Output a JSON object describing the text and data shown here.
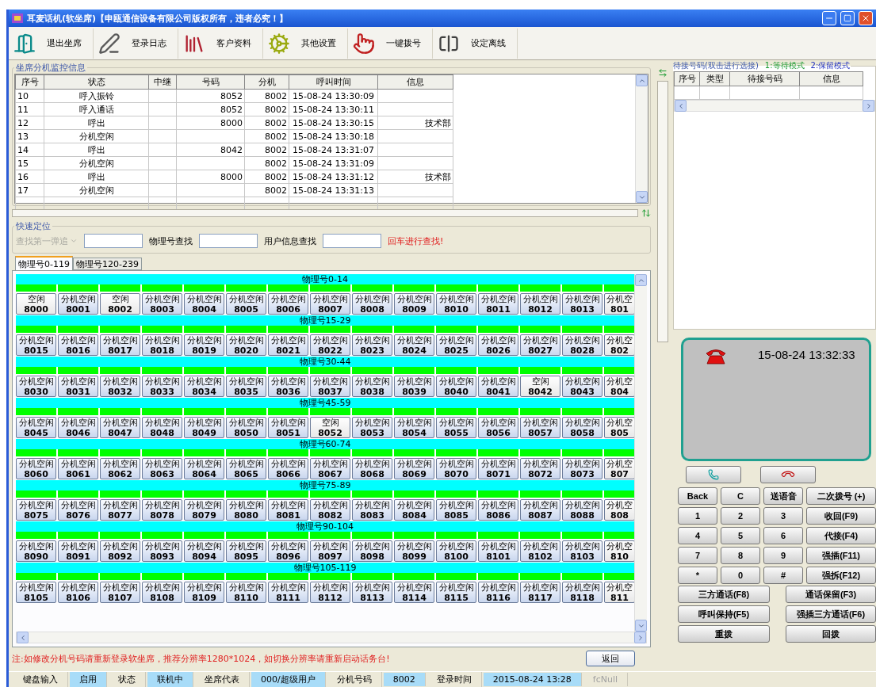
{
  "window": {
    "title": "耳麦话机(软坐席)【申瓯通信设备有限公司版权所有，违者必究！】"
  },
  "toolbar": [
    "退出坐席",
    "登录日志",
    "客户资料",
    "其他设置",
    "一键拨号",
    "设定离线"
  ],
  "monitor": {
    "title": "坐席分机监控信息",
    "columns": [
      "序号",
      "状态",
      "中继",
      "号码",
      "分机",
      "呼叫时间",
      "信息"
    ],
    "rows": [
      [
        "10",
        "呼入振铃",
        "",
        "8052",
        "8002",
        "15-08-24 13:30:09",
        ""
      ],
      [
        "11",
        "呼入通话",
        "",
        "8052",
        "8002",
        "15-08-24 13:30:11",
        ""
      ],
      [
        "12",
        "呼出",
        "",
        "8000",
        "8002",
        "15-08-24 13:30:15",
        "技术部"
      ],
      [
        "13",
        "分机空闲",
        "",
        "",
        "8002",
        "15-08-24 13:30:18",
        ""
      ],
      [
        "14",
        "呼出",
        "",
        "8042",
        "8002",
        "15-08-24 13:31:07",
        ""
      ],
      [
        "15",
        "分机空闲",
        "",
        "",
        "8002",
        "15-08-24 13:31:09",
        ""
      ],
      [
        "16",
        "呼出",
        "",
        "8000",
        "8002",
        "15-08-24 13:31:12",
        "技术部"
      ],
      [
        "17",
        "分机空闲",
        "",
        "",
        "8002",
        "15-08-24 13:31:13",
        ""
      ]
    ]
  },
  "quick_search": {
    "title": "快速定位",
    "dropdown": "查找第一弹追",
    "physical_label": "物理号查找",
    "user_label": "用户信息查找",
    "hint": "回车进行查找!"
  },
  "tabs": [
    {
      "label": "物理号0-119",
      "selected": true
    },
    {
      "label": "物理号120-239",
      "selected": false
    }
  ],
  "groups": [
    {
      "title": "物理号0-14",
      "cells": [
        {
          "status": "空闲",
          "number": "8000"
        },
        {
          "status": "分机空闲",
          "number": "8001"
        },
        {
          "status": "空闲",
          "number": "8002"
        },
        {
          "status": "分机空闲",
          "number": "8003"
        },
        {
          "status": "分机空闲",
          "number": "8004"
        },
        {
          "status": "分机空闲",
          "number": "8005"
        },
        {
          "status": "分机空闲",
          "number": "8006"
        },
        {
          "status": "分机空闲",
          "number": "8007"
        },
        {
          "status": "分机空闲",
          "number": "8008"
        },
        {
          "status": "分机空闲",
          "number": "8009"
        },
        {
          "status": "分机空闲",
          "number": "8010"
        },
        {
          "status": "分机空闲",
          "number": "8011"
        },
        {
          "status": "分机空闲",
          "number": "8012"
        },
        {
          "status": "分机空闲",
          "number": "8013"
        },
        {
          "status": "分机空",
          "number": "801"
        }
      ]
    },
    {
      "title": "物理号15-29",
      "cells": [
        {
          "status": "分机空闲",
          "number": "8015"
        },
        {
          "status": "分机空闲",
          "number": "8016"
        },
        {
          "status": "分机空闲",
          "number": "8017"
        },
        {
          "status": "分机空闲",
          "number": "8018"
        },
        {
          "status": "分机空闲",
          "number": "8019"
        },
        {
          "status": "分机空闲",
          "number": "8020"
        },
        {
          "status": "分机空闲",
          "number": "8021"
        },
        {
          "status": "分机空闲",
          "number": "8022"
        },
        {
          "status": "分机空闲",
          "number": "8023"
        },
        {
          "status": "分机空闲",
          "number": "8024"
        },
        {
          "status": "分机空闲",
          "number": "8025"
        },
        {
          "status": "分机空闲",
          "number": "8026"
        },
        {
          "status": "分机空闲",
          "number": "8027"
        },
        {
          "status": "分机空闲",
          "number": "8028"
        },
        {
          "status": "分机空",
          "number": "802"
        }
      ]
    },
    {
      "title": "物理号30-44",
      "cells": [
        {
          "status": "分机空闲",
          "number": "8030"
        },
        {
          "status": "分机空闲",
          "number": "8031"
        },
        {
          "status": "分机空闲",
          "number": "8032"
        },
        {
          "status": "分机空闲",
          "number": "8033"
        },
        {
          "status": "分机空闲",
          "number": "8034"
        },
        {
          "status": "分机空闲",
          "number": "8035"
        },
        {
          "status": "分机空闲",
          "number": "8036"
        },
        {
          "status": "分机空闲",
          "number": "8037"
        },
        {
          "status": "分机空闲",
          "number": "8038"
        },
        {
          "status": "分机空闲",
          "number": "8039"
        },
        {
          "status": "分机空闲",
          "number": "8040"
        },
        {
          "status": "分机空闲",
          "number": "8041"
        },
        {
          "status": "空闲",
          "number": "8042"
        },
        {
          "status": "分机空闲",
          "number": "8043"
        },
        {
          "status": "分机空",
          "number": "804"
        }
      ]
    },
    {
      "title": "物理号45-59",
      "cells": [
        {
          "status": "分机空闲",
          "number": "8045"
        },
        {
          "status": "分机空闲",
          "number": "8046"
        },
        {
          "status": "分机空闲",
          "number": "8047"
        },
        {
          "status": "分机空闲",
          "number": "8048"
        },
        {
          "status": "分机空闲",
          "number": "8049"
        },
        {
          "status": "分机空闲",
          "number": "8050"
        },
        {
          "status": "分机空闲",
          "number": "8051"
        },
        {
          "status": "空闲",
          "number": "8052"
        },
        {
          "status": "分机空闲",
          "number": "8053"
        },
        {
          "status": "分机空闲",
          "number": "8054"
        },
        {
          "status": "分机空闲",
          "number": "8055"
        },
        {
          "status": "分机空闲",
          "number": "8056"
        },
        {
          "status": "分机空闲",
          "number": "8057"
        },
        {
          "status": "分机空闲",
          "number": "8058"
        },
        {
          "status": "分机空",
          "number": "805"
        }
      ]
    },
    {
      "title": "物理号60-74",
      "cells": [
        {
          "status": "分机空闲",
          "number": "8060"
        },
        {
          "status": "分机空闲",
          "number": "8061"
        },
        {
          "status": "分机空闲",
          "number": "8062"
        },
        {
          "status": "分机空闲",
          "number": "8063"
        },
        {
          "status": "分机空闲",
          "number": "8064"
        },
        {
          "status": "分机空闲",
          "number": "8065"
        },
        {
          "status": "分机空闲",
          "number": "8066"
        },
        {
          "status": "分机空闲",
          "number": "8067"
        },
        {
          "status": "分机空闲",
          "number": "8068"
        },
        {
          "status": "分机空闲",
          "number": "8069"
        },
        {
          "status": "分机空闲",
          "number": "8070"
        },
        {
          "status": "分机空闲",
          "number": "8071"
        },
        {
          "status": "分机空闲",
          "number": "8072"
        },
        {
          "status": "分机空闲",
          "number": "8073"
        },
        {
          "status": "分机空",
          "number": "807"
        }
      ]
    },
    {
      "title": "物理号75-89",
      "cells": [
        {
          "status": "分机空闲",
          "number": "8075"
        },
        {
          "status": "分机空闲",
          "number": "8076"
        },
        {
          "status": "分机空闲",
          "number": "8077"
        },
        {
          "status": "分机空闲",
          "number": "8078"
        },
        {
          "status": "分机空闲",
          "number": "8079"
        },
        {
          "status": "分机空闲",
          "number": "8080"
        },
        {
          "status": "分机空闲",
          "number": "8081"
        },
        {
          "status": "分机空闲",
          "number": "8082"
        },
        {
          "status": "分机空闲",
          "number": "8083"
        },
        {
          "status": "分机空闲",
          "number": "8084"
        },
        {
          "status": "分机空闲",
          "number": "8085"
        },
        {
          "status": "分机空闲",
          "number": "8086"
        },
        {
          "status": "分机空闲",
          "number": "8087"
        },
        {
          "status": "分机空闲",
          "number": "8088"
        },
        {
          "status": "分机空",
          "number": "808"
        }
      ]
    },
    {
      "title": "物理号90-104",
      "cells": [
        {
          "status": "分机空闲",
          "number": "8090"
        },
        {
          "status": "分机空闲",
          "number": "8091"
        },
        {
          "status": "分机空闲",
          "number": "8092"
        },
        {
          "status": "分机空闲",
          "number": "8093"
        },
        {
          "status": "分机空闲",
          "number": "8094"
        },
        {
          "status": "分机空闲",
          "number": "8095"
        },
        {
          "status": "分机空闲",
          "number": "8096"
        },
        {
          "status": "分机空闲",
          "number": "8097"
        },
        {
          "status": "分机空闲",
          "number": "8098"
        },
        {
          "status": "分机空闲",
          "number": "8099"
        },
        {
          "status": "分机空闲",
          "number": "8100"
        },
        {
          "status": "分机空闲",
          "number": "8101"
        },
        {
          "status": "分机空闲",
          "number": "8102"
        },
        {
          "status": "分机空闲",
          "number": "8103"
        },
        {
          "status": "分机空",
          "number": "810"
        }
      ]
    },
    {
      "title": "物理号105-119",
      "cells": [
        {
          "status": "分机空闲",
          "number": "8105"
        },
        {
          "status": "分机空闲",
          "number": "8106"
        },
        {
          "status": "分机空闲",
          "number": "8107"
        },
        {
          "status": "分机空闲",
          "number": "8108"
        },
        {
          "status": "分机空闲",
          "number": "8109"
        },
        {
          "status": "分机空闲",
          "number": "8110"
        },
        {
          "status": "分机空闲",
          "number": "8111"
        },
        {
          "status": "分机空闲",
          "number": "8112"
        },
        {
          "status": "分机空闲",
          "number": "8113"
        },
        {
          "status": "分机空闲",
          "number": "8114"
        },
        {
          "status": "分机空闲",
          "number": "8115"
        },
        {
          "status": "分机空闲",
          "number": "8116"
        },
        {
          "status": "分机空闲",
          "number": "8117"
        },
        {
          "status": "分机空闲",
          "number": "8118"
        },
        {
          "status": "分机空",
          "number": "811"
        }
      ]
    }
  ],
  "note": "注:如修改分机号码请重新登录软坐席，推荐分辨率1280*1024，如切换分辨率请重新启动话务台!",
  "back_button": "返回",
  "waiting": {
    "title": "待接号码(双击进行选接)",
    "mode_wait": "1:等待模式",
    "mode_hold": "2:保留模式",
    "columns": [
      "序号",
      "类型",
      "待接号码",
      "信息"
    ]
  },
  "display": {
    "time": "15-08-24 13:32:33"
  },
  "keys": [
    "Back",
    "C",
    "送语音",
    "二次拨号 (+)",
    "1",
    "2",
    "3",
    "收回(F9)",
    "4",
    "5",
    "6",
    "代接(F4)",
    "7",
    "8",
    "9",
    "强插(F11)",
    "*",
    "0",
    "#",
    "强拆(F12)"
  ],
  "wide_keys": [
    "三方通话(F8)",
    "通话保留(F3)",
    "呼叫保持(F5)",
    "强插三方通话(F6)",
    "重拨",
    "回拨"
  ],
  "status_bar": [
    {
      "text": "键盘输入",
      "kind": "label"
    },
    {
      "text": "启用",
      "kind": "value"
    },
    {
      "text": "状态",
      "kind": "label"
    },
    {
      "text": "联机中",
      "kind": "value"
    },
    {
      "text": "坐席代表",
      "kind": "label"
    },
    {
      "text": "000/超级用户",
      "kind": "value"
    },
    {
      "text": "分机号码",
      "kind": "label"
    },
    {
      "text": "8002",
      "kind": "value"
    },
    {
      "text": "登录时间",
      "kind": "label"
    },
    {
      "text": "2015-08-24 13:28",
      "kind": "value"
    },
    {
      "text": "fcNull",
      "kind": "muted"
    }
  ]
}
